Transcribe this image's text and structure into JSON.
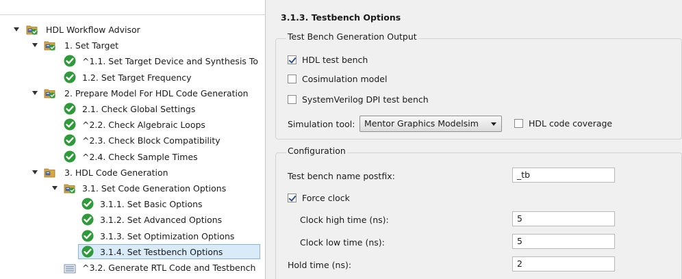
{
  "tree": {
    "items": [
      {
        "label": "HDL Workflow Advisor",
        "icon": "folder-check-icon",
        "level": 0,
        "expanded": true
      },
      {
        "label": "1. Set Target",
        "icon": "folder-check-icon",
        "level": 1,
        "expanded": true
      },
      {
        "label": "^1.1. Set Target Device and Synthesis To",
        "icon": "passed-check-icon",
        "level": 2
      },
      {
        "label": "1.2. Set Target Frequency",
        "icon": "passed-check-icon",
        "level": 2
      },
      {
        "label": "2. Prepare Model For HDL Code Generation",
        "icon": "folder-check-icon",
        "level": 1,
        "expanded": true
      },
      {
        "label": "2.1. Check Global Settings",
        "icon": "passed-check-icon",
        "level": 2
      },
      {
        "label": "^2.2. Check Algebraic Loops",
        "icon": "passed-check-icon",
        "level": 2
      },
      {
        "label": "^2.3. Check Block Compatibility",
        "icon": "passed-check-icon",
        "level": 2
      },
      {
        "label": "^2.4. Check Sample Times",
        "icon": "passed-check-icon",
        "level": 2
      },
      {
        "label": "3. HDL Code Generation",
        "icon": "folder-icon",
        "level": 1,
        "expanded": true
      },
      {
        "label": "3.1. Set Code Generation Options",
        "icon": "folder-check-icon",
        "level": 2,
        "expanded": true
      },
      {
        "label": "3.1.1. Set Basic Options",
        "icon": "passed-check-icon",
        "level": 3
      },
      {
        "label": "3.1.2. Set Advanced Options",
        "icon": "passed-check-icon",
        "level": 3
      },
      {
        "label": "3.1.3. Set Optimization Options",
        "icon": "passed-check-icon",
        "level": 3
      },
      {
        "label": "3.1.4. Set Testbench Options",
        "icon": "passed-check-icon",
        "level": 3,
        "selected": true
      },
      {
        "label": "^3.2. Generate RTL Code and Testbench",
        "icon": "task-doc-icon",
        "level": 2
      }
    ]
  },
  "panel": {
    "title": "3.1.3. Testbench Options",
    "output_group": {
      "label": "Test Bench Generation Output",
      "hdl_test_bench": {
        "label": "HDL test bench",
        "checked": true
      },
      "cosimulation_model": {
        "label": "Cosimulation model",
        "checked": false
      },
      "systemverilog_dpi": {
        "label": "SystemVerilog DPI test bench",
        "checked": false
      },
      "simulation_tool_label": "Simulation tool:",
      "simulation_tool_value": "Mentor Graphics Modelsim",
      "hdl_code_coverage": {
        "label": "HDL code coverage",
        "checked": false
      }
    },
    "configuration_group": {
      "label": "Configuration",
      "postfix_label": "Test bench name postfix:",
      "postfix_value": "_tb",
      "force_clock": {
        "label": "Force clock",
        "checked": true
      },
      "clock_high_label": "Clock high time (ns):",
      "clock_high_value": "5",
      "clock_low_label": "Clock low time (ns):",
      "clock_low_value": "5",
      "hold_time_label": "Hold time (ns):",
      "hold_time_value": "2"
    }
  },
  "colors": {
    "passed_green": "#2e9a3a",
    "selection_bg": "#d9eaf9",
    "panel_bg": "#f0f0f0"
  }
}
